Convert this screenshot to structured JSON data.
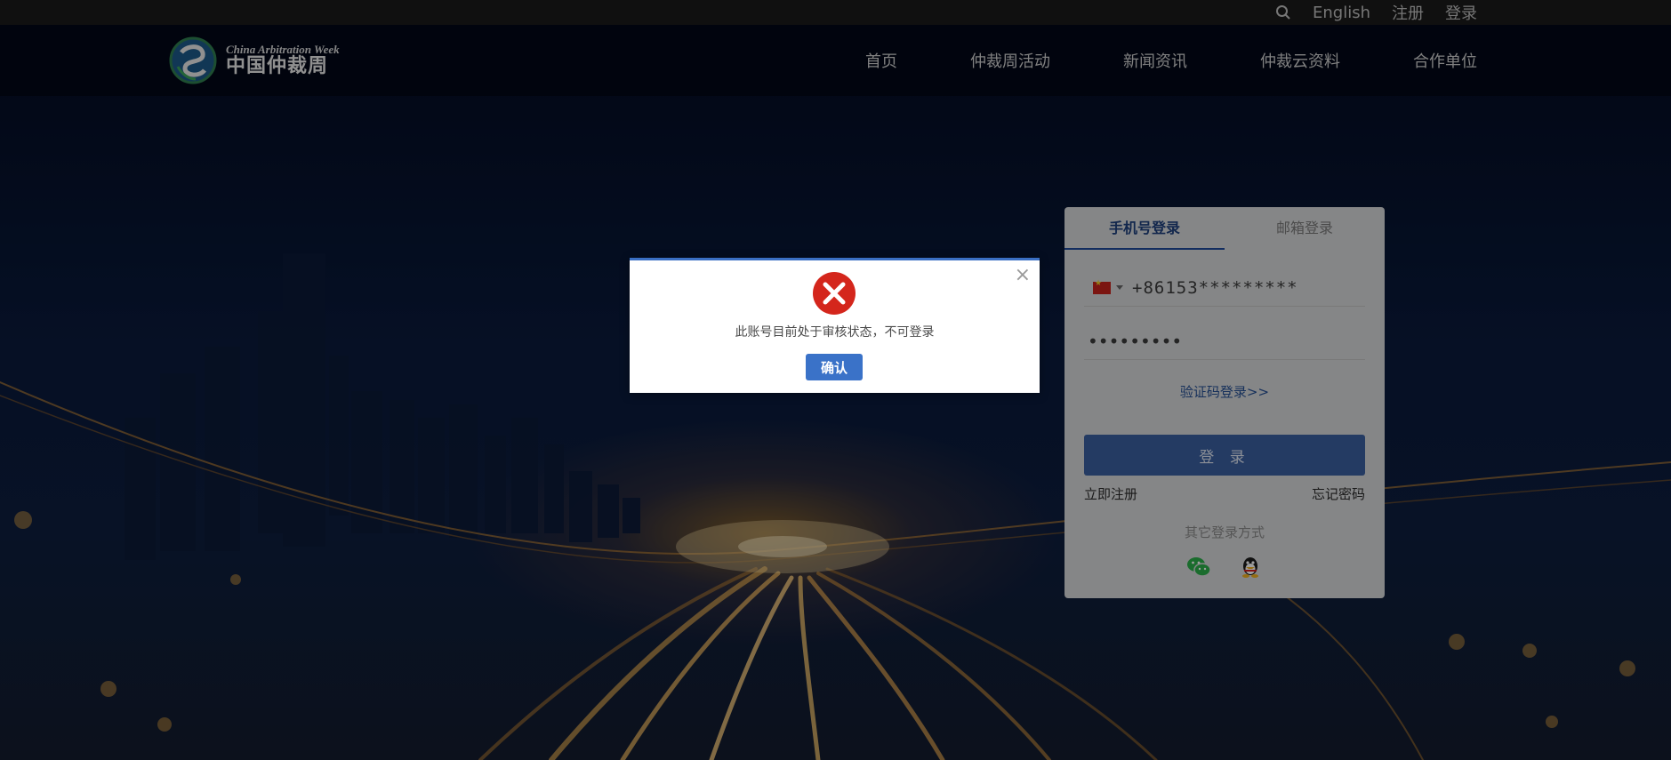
{
  "topbar": {
    "search_icon": "search-icon",
    "language": "English",
    "register": "注册",
    "login": "登录"
  },
  "header": {
    "logo_en": "China Arbitration Week",
    "logo_cn": "中国仲裁周",
    "nav": [
      "首页",
      "仲裁周活动",
      "新闻资讯",
      "仲裁云资料",
      "合作单位"
    ]
  },
  "login_panel": {
    "tabs": [
      "手机号登录",
      "邮箱登录"
    ],
    "active_tab": "手机号登录",
    "phone_value": "+86153*********",
    "password_value": "•••••••••",
    "captcha_link": "验证码登录>>",
    "submit": "登 录",
    "register_link": "立即注册",
    "forgot_link": "忘记密码",
    "other_methods": "其它登录方式",
    "social_icons": [
      "wechat-icon",
      "qq-icon"
    ]
  },
  "modal": {
    "close": "×",
    "message": "此账号目前处于审核状态，不可登录",
    "confirm": "确认",
    "icon": "error-icon"
  },
  "colors": {
    "accent": "#3a72c8",
    "login_button": "#3b5fa0",
    "error": "#d4261c"
  }
}
